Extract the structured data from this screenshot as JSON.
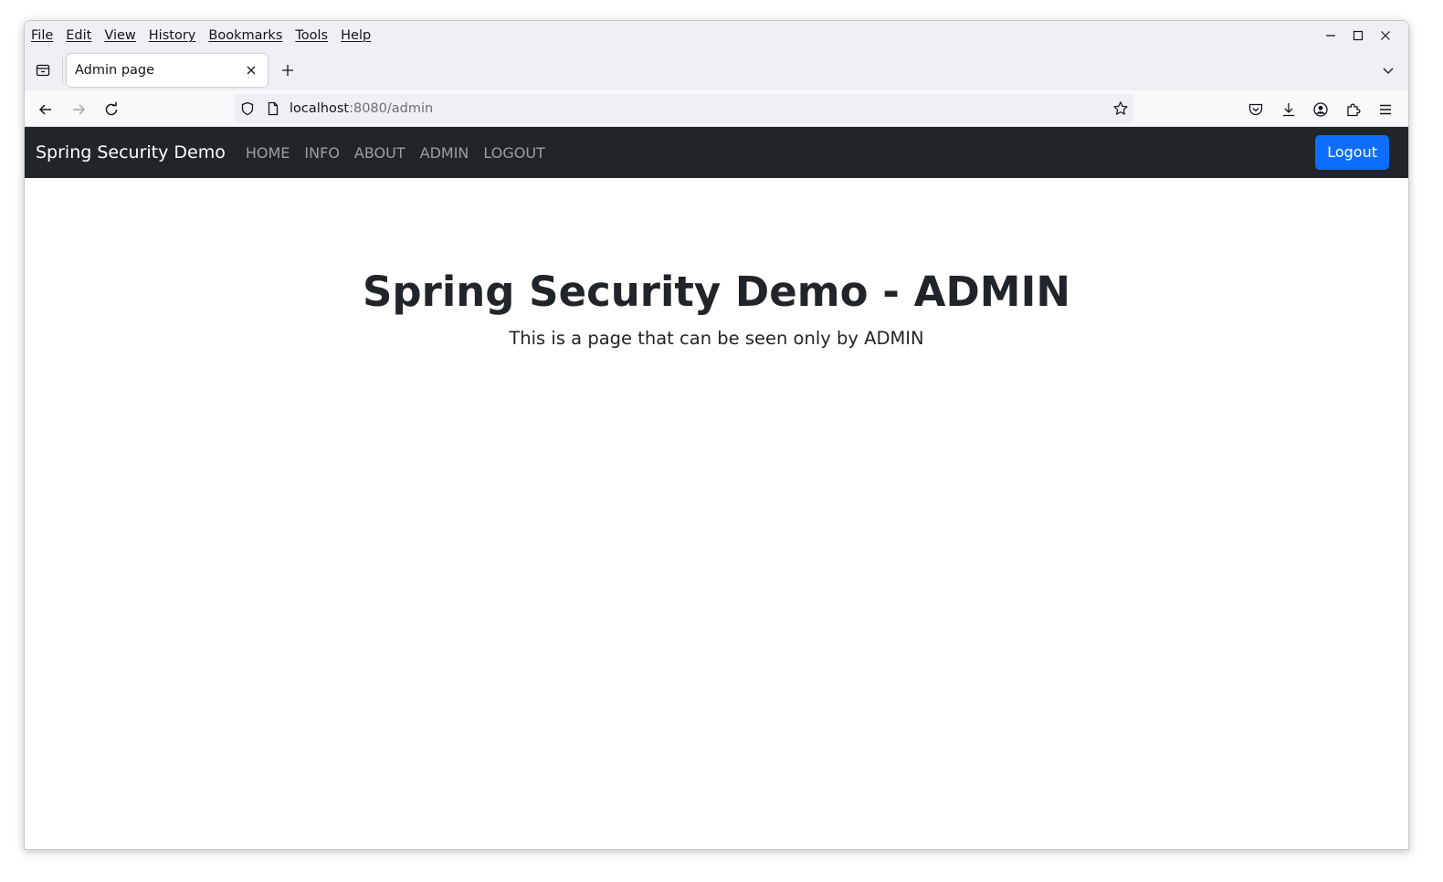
{
  "browser": {
    "menu": [
      "File",
      "Edit",
      "View",
      "History",
      "Bookmarks",
      "Tools",
      "Help"
    ],
    "tab": {
      "title": "Admin page"
    },
    "url": {
      "host": "localhost",
      "rest": ":8080/admin"
    }
  },
  "site": {
    "brand": "Spring Security Demo",
    "nav": [
      "HOME",
      "INFO",
      "ABOUT",
      "ADMIN",
      "LOGOUT"
    ],
    "logout_button": "Logout",
    "heading": "Spring Security Demo - ADMIN",
    "subheading": "This is a page that can be seen only by ADMIN"
  },
  "colors": {
    "navbar_bg": "#212529",
    "button_primary": "#0d6efd"
  }
}
